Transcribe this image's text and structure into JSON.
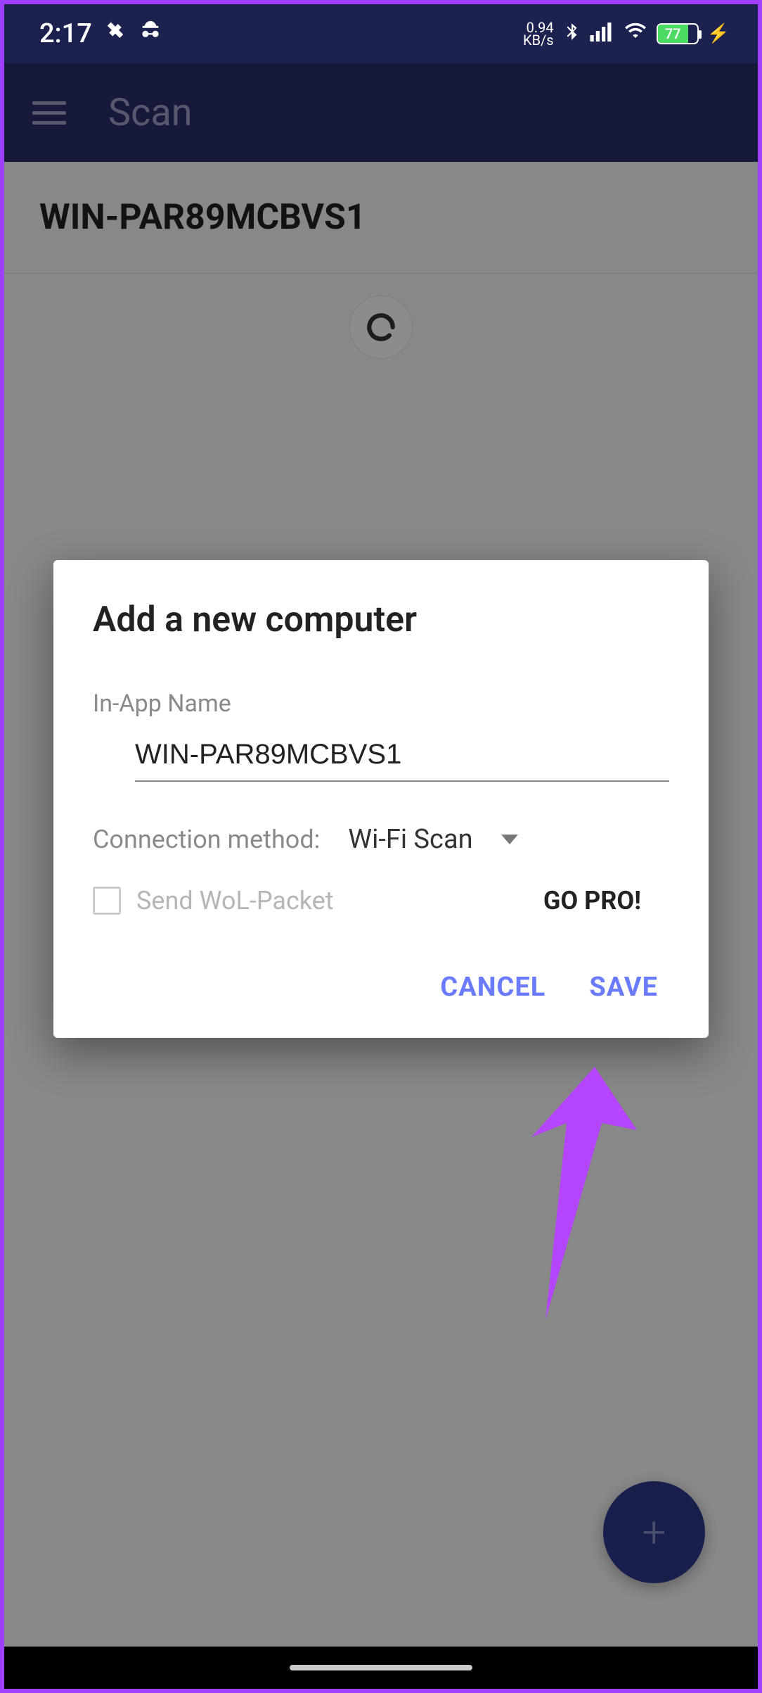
{
  "status": {
    "time": "2:17",
    "speed_value": "0.94",
    "speed_unit": "KB/s",
    "battery_pct": "77"
  },
  "appbar": {
    "title": "Scan"
  },
  "main": {
    "device_name": "WIN-PAR89MCBVS1"
  },
  "dialog": {
    "title": "Add a new computer",
    "field_label": "In-App Name",
    "name_value": "WIN-PAR89MCBVS1",
    "conn_method_label": "Connection method:",
    "conn_method_value": "Wi-Fi Scan",
    "wol_label": "Send WoL-Packet",
    "gopro_label": "GO PRO!",
    "cancel_label": "CANCEL",
    "save_label": "SAVE"
  },
  "fab": {
    "plus": "+"
  }
}
